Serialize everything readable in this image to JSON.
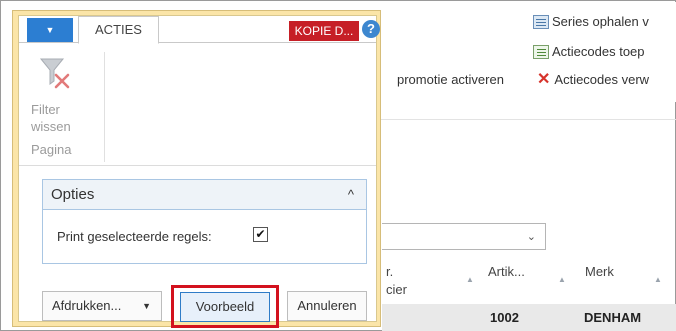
{
  "background": {
    "ribbon": {
      "series_ophalen": "Series ophalen v",
      "actiecodes_toep": "Actiecodes toep",
      "promotie_activeren": "promotie activeren",
      "actiecodes_verw": "Actiecodes verw",
      "icons": [
        "series-icon",
        "actiecodes-icon",
        "delete-x-icon"
      ]
    },
    "grid": {
      "columns": [
        {
          "label_line1": "r.",
          "label_line2": "cier"
        },
        {
          "label_line1": "Artik..."
        },
        {
          "label_line1": "Merk"
        }
      ],
      "rows": [
        {
          "artikel": "1002",
          "merk": "DENHAM"
        }
      ]
    }
  },
  "dialog": {
    "tabs": {
      "menu_arrow": "▼",
      "acties_tab": "ACTIES"
    },
    "badge": "KOPIE D...",
    "help_label": "?",
    "ribbon": {
      "filter_wissen_line1": "Filter",
      "filter_wissen_line2": "wissen",
      "group_label": "Pagina"
    },
    "options": {
      "title": "Opties",
      "collapse_glyph": "^",
      "print_selected_label": "Print geselecteerde regels:",
      "print_selected_checked": true
    },
    "buttons": {
      "afdrukken": "Afdrukken...",
      "afdrukken_arrow": "▼",
      "voorbeeld": "Voorbeeld",
      "annuleren": "Annuleren"
    }
  },
  "colors": {
    "dialog_frame": "#fbe5a8",
    "menu_button": "#2c7ed2",
    "badge": "#c61f26",
    "highlight": "#d3111e",
    "options_border": "#a9c6e3"
  }
}
